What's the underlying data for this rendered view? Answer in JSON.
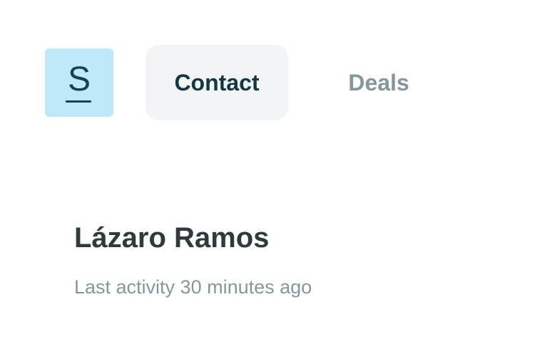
{
  "brand": {
    "logo_letter": "S",
    "logo_bg_color": "#bfe9f8",
    "logo_fg_color": "#17414f"
  },
  "tabs": [
    {
      "label": "Contact",
      "active": true
    },
    {
      "label": "Deals",
      "active": false
    }
  ],
  "contact": {
    "name": "Lázaro Ramos",
    "activity": "Last activity 30 minutes ago"
  },
  "colors": {
    "active_tab_bg": "#f3f4f6",
    "active_tab_text": "#123844",
    "inactive_tab_text": "#84979d",
    "name_text": "#2f3a3d",
    "muted_text": "#84979d"
  }
}
